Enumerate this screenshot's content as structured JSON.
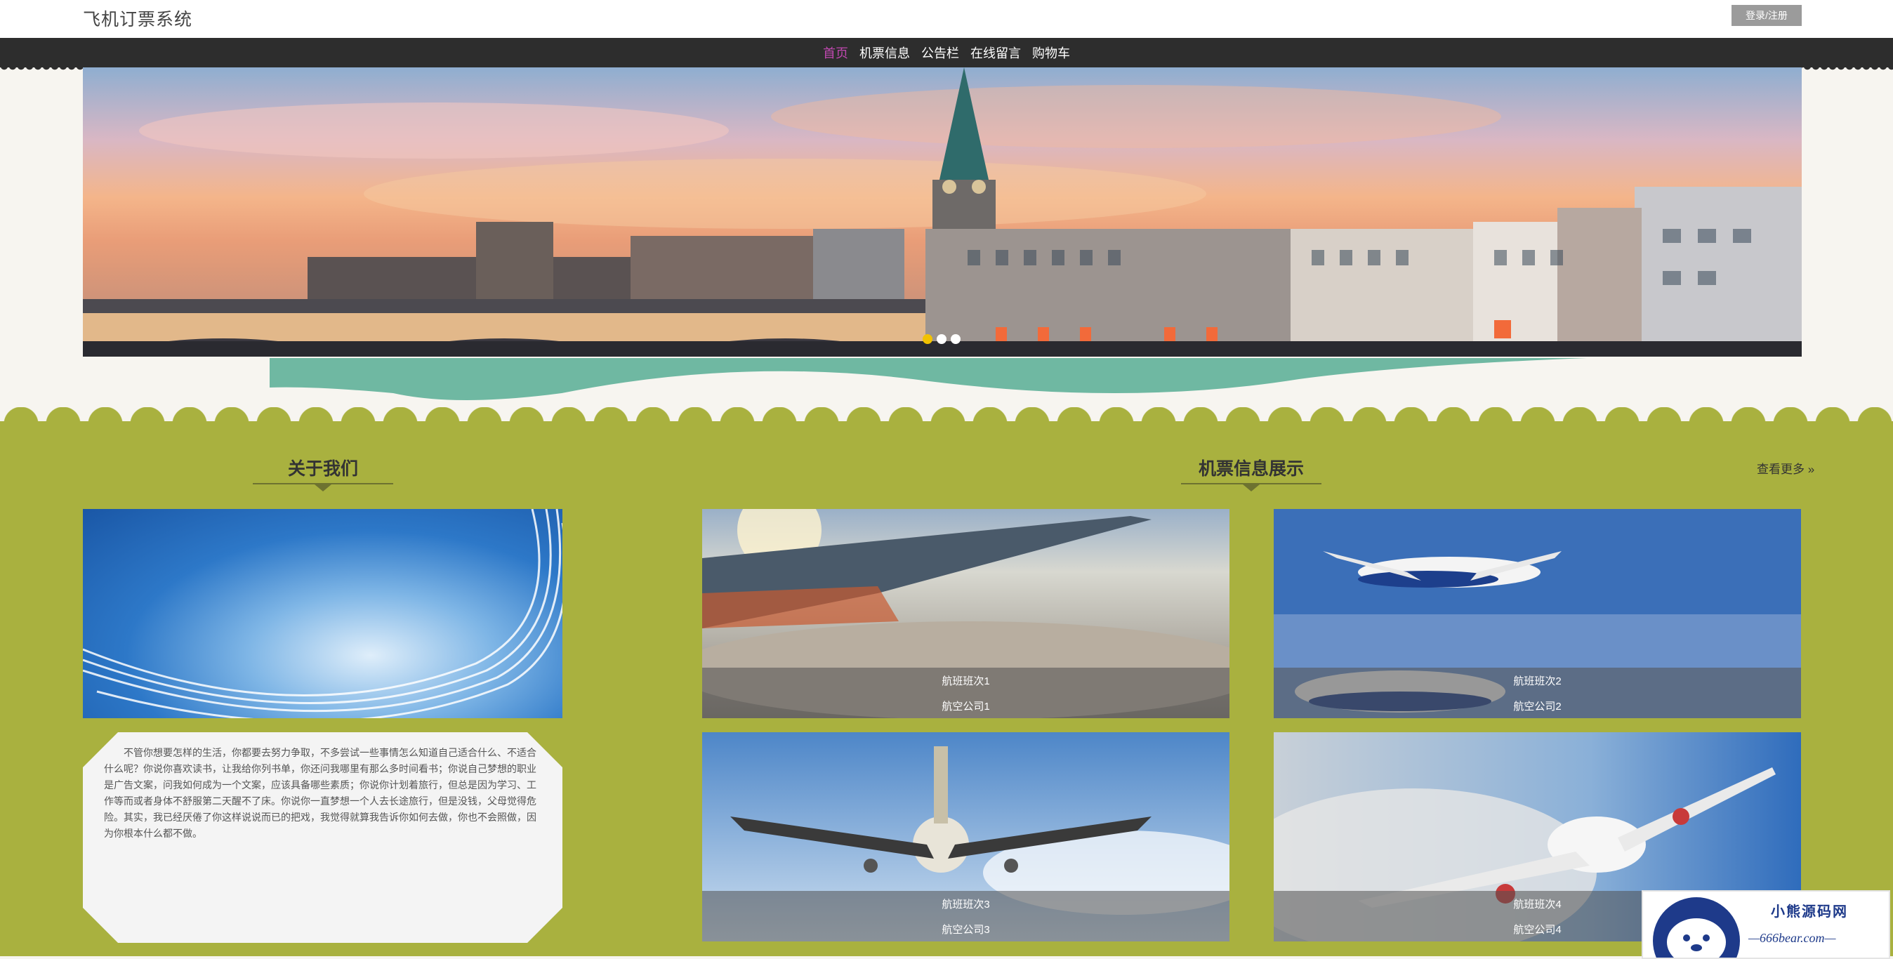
{
  "header": {
    "title": "飞机订票系统",
    "login_label": "登录/注册"
  },
  "nav": {
    "items": [
      "首页",
      "机票信息",
      "公告栏",
      "在线留言",
      "购物车"
    ],
    "active_index": 0
  },
  "banner": {
    "slide_count": 3,
    "active_slide": 0
  },
  "about": {
    "heading": "关于我们",
    "text": "不管你想要怎样的生活，你都要去努力争取，不多尝试一些事情怎么知道自己适合什么、不适合什么呢？你说你喜欢读书，让我给你列书单，你还问我哪里有那么多时间看书；你说自己梦想的职业是广告文案，问我如何成为一个文案，应该具备哪些素质；你说你计划着旅行，但总是因为学习、工作等而或者身体不舒服第二天醒不了床。你说你一直梦想一个人去长途旅行，但是没钱，父母觉得危险。其实，我已经厌倦了你这样说说而已的把戏，我觉得就算我告诉你如何去做，你也不会照做，因为你根本什么都不做。"
  },
  "flights": {
    "heading": "机票信息展示",
    "view_more": "查看更多 »",
    "cards": [
      {
        "flight": "航班班次1",
        "airline": "航空公司1"
      },
      {
        "flight": "航班班次2",
        "airline": "航空公司2"
      },
      {
        "flight": "航班班次3",
        "airline": "航空公司3"
      },
      {
        "flight": "航班班次4",
        "airline": "航空公司4"
      }
    ]
  },
  "watermark": {
    "line1": "小熊源码网",
    "line2": "—666bear.com—"
  },
  "colors": {
    "nav_bg": "#2d2d2d",
    "nav_active": "#c048b0",
    "section_bg": "#a9b13f",
    "wave": "#6fb8a2"
  }
}
